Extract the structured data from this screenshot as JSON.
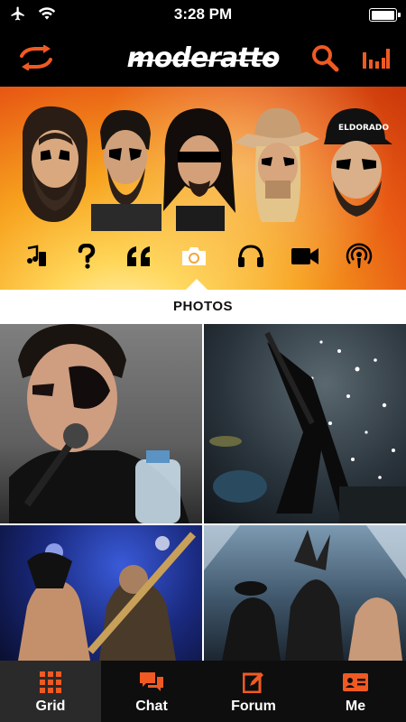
{
  "status_bar": {
    "time": "3:28 PM",
    "icons": [
      "airplane-icon",
      "wifi-icon",
      "battery-icon"
    ],
    "battery_level": 0.9
  },
  "header": {
    "logo_text": "moderatto",
    "left_icon": "refresh-icon",
    "right_icons": [
      "search-icon",
      "levels-icon"
    ],
    "accent_color": "#f05a22"
  },
  "banner": {
    "section_icons": [
      "music-notes-icon",
      "question-icon",
      "quote-icon",
      "camera-icon",
      "headphones-icon",
      "video-icon",
      "podcast-icon"
    ],
    "selected_icon": "camera-icon"
  },
  "section": {
    "title": "PHOTOS"
  },
  "tabs": [
    {
      "label": "Grid",
      "icon": "grid-icon",
      "active": true
    },
    {
      "label": "Chat",
      "icon": "chat-icon",
      "active": false
    },
    {
      "label": "Forum",
      "icon": "forum-icon",
      "active": false
    },
    {
      "label": "Me",
      "icon": "profile-card-icon",
      "active": false
    }
  ]
}
